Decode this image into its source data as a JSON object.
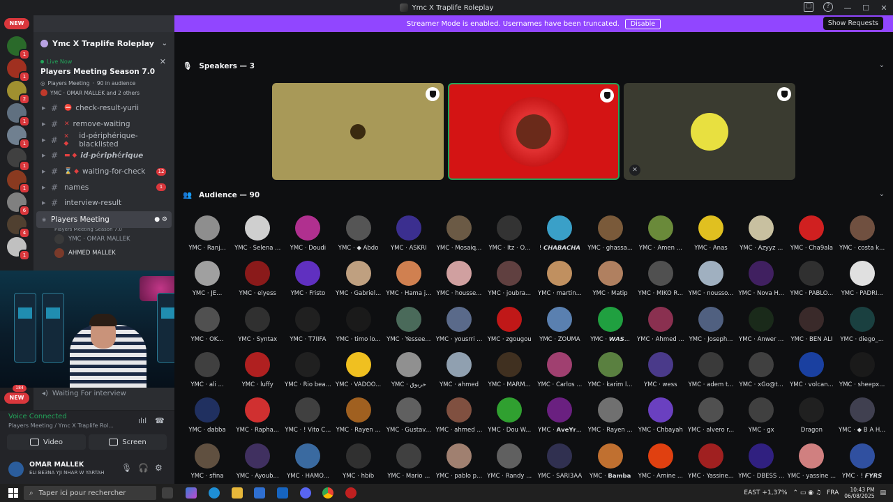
{
  "window": {
    "title": "Ymc X Traplife Roleplay"
  },
  "banner": {
    "message": "Streamer Mode is enabled. Usernames have been truncated.",
    "disable_label": "Disable",
    "show_requests": "Show Requests"
  },
  "rail": {
    "new_label": "NEW",
    "badges": [
      "1",
      "1",
      "2",
      "1",
      "1",
      "1",
      "1",
      "6",
      "4",
      "1"
    ],
    "bottom_badge": "184",
    "new_label_2": "NEW"
  },
  "sidebar": {
    "server_name": "Ymc X Traplife Roleplay",
    "live": {
      "label": "Live Now",
      "title": "Players Meeting Season 7.0",
      "stage_name": "Players Meeting",
      "audience": "90 in audience",
      "speakers_text": "YMC · OMAR MALLEK and 2 others"
    },
    "channels": [
      {
        "name": "check-result-yurii",
        "prefix": "⛔",
        "badge": ""
      },
      {
        "name": "remove-waiting",
        "prefix": "✕",
        "badge": ""
      },
      {
        "name": "id-périphérique-blacklisted",
        "prefix": "✕ ◆",
        "badge": ""
      },
      {
        "name": "𝙞𝙙-𝙥é𝙧𝙞𝙥𝙝é𝙧𝙞𝙦𝙪𝙚",
        "prefix": "▬ ◆",
        "badge": ""
      },
      {
        "name": "waiting-for-check",
        "prefix": "⌛ ◆",
        "badge": "12"
      },
      {
        "name": "names",
        "prefix": "",
        "badge": "1"
      },
      {
        "name": "interview-result",
        "prefix": "",
        "badge": ""
      }
    ],
    "active_stage": {
      "name": "Players Meeting",
      "sub": "Players Meeting Season 7.0"
    },
    "voice_users": [
      "YMC · OMAR MALLEK",
      "AHMED MALLEK"
    ],
    "waiting_channel": "Waiting For interview"
  },
  "voice": {
    "status": "Voice Connected",
    "location": "Players Meeting / Ymc X Traplife Rol...",
    "video_label": "Video",
    "screen_label": "Screen"
  },
  "user": {
    "name": "OMAR MALLEK",
    "status": "ELI BE3NA YJI NHAR W YARTAH"
  },
  "stage": {
    "speakers_label": "Speakers — 3",
    "audience_label": "Audience — 90",
    "speakers": [
      {
        "bg": "#a89958"
      },
      {
        "bg": "#d41414"
      },
      {
        "bg": "#3a3b30"
      }
    ],
    "audience": [
      "YMC · Ranj...",
      "YMC · Selena ...",
      "YMC · Doudi",
      "YMC · ◆ Abdo",
      "YMC · ASKRI",
      "YMC · Mosaiq...",
      "YMC · Itz · O...",
      "! 𝘾𝙃𝘼𝘽𝘼𝘾𝙃𝘼",
      "YMC · ghassa...",
      "YMC · Amen ...",
      "YMC · Anas",
      "YMC · Azyyz ...",
      "YMC · Cha9ala",
      "YMC · costa k...",
      "YMC · JE...",
      "YMC · elyess",
      "YMC · Fristo",
      "YMC · Gabriel...",
      "YMC · Hama j...",
      "YMC · housse...",
      "YMC · joubra...",
      "YMC · martin...",
      "YMC · Matip",
      "YMC · MIKO R...",
      "YMC · nousso...",
      "YMC · Nova H...",
      "YMC · PABLO...",
      "YMC · PADRI...",
      "YMC · OK...",
      "YMC · Syntax",
      "YMC · T7IIFA",
      "YMC · timo lo...",
      "YMC · Yessee...",
      "YMC · yousrri ...",
      "YMC · zgougou",
      "YMC · ZOUMA",
      "YMC · 𝙒𝘼𝙎...",
      "YMC · Ahmed ...",
      "YMC · Joseph...",
      "YMC · Anwer ...",
      "YMC · BEN ALI",
      "YMC · diego_...",
      "YMC · ali ...",
      "YMC · luffy",
      "YMC · Rio bea...",
      "YMC · VADOO...",
      "YMC · خربوق",
      "YMC · ahmed",
      "YMC · MARM...",
      "YMC · Carlos ...",
      "YMC · karim l...",
      "YMC · wess",
      "YMC · adem t...",
      "YMC · xGo@t...",
      "YMC · volcan...",
      "YMC · sheepx...",
      "YMC · dabba",
      "YMC · Rapha...",
      "YMC · ! Vito C...",
      "YMC · Rayen ...",
      "YMC · Gustav...",
      "YMC · ahmed ...",
      "YMC · Dou W...",
      "YMC · 𝗔𝘃𝗲𝗬𝗿...",
      "YMC · Rayen ...",
      "YMC · Chbayah",
      "YMC · alvero r...",
      "YMC · gx",
      "Dragon",
      "YMC · ◆ B A H...",
      "YMC · sfina",
      "YMC · Ayoub...",
      "YMC · HAMO...",
      "YMC · hbib",
      "YMC · Mario ...",
      "YMC · pablo p...",
      "YMC · Randy ...",
      "YMC · SARI3AA",
      "YMC · 𝗕𝗮𝗺𝗯𝗮",
      "YMC · Amine ...",
      "YMC · Yassine...",
      "YMC · DBESS ...",
      "YMC · yassine ...",
      "YMC · ! 𝙁𝙔𝙍𝙎"
    ],
    "audience_colors": [
      "#8e8e8e",
      "#cfcfcf",
      "#b0308f",
      "#555555",
      "#3b2f8f",
      "#6b5a45",
      "#333333",
      "#3aa0c8",
      "#7a5a3a",
      "#6a8a3a",
      "#e0c020",
      "#c8c0a0",
      "#d02020",
      "#705040",
      "#a0a0a0",
      "#8a1a1a",
      "#6030c0",
      "#bfa080",
      "#d08050",
      "#d0a0a0",
      "#604040",
      "#c09060",
      "#b08060",
      "#505050",
      "#a0b0c0",
      "#402060",
      "#303030",
      "#e0e0e0",
      "#505050",
      "#303030",
      "#202020",
      "#1a1a1a",
      "#4a6a5a",
      "#5a6a8a",
      "#c01818",
      "#5a80b0",
      "#20a040",
      "#8a3050",
      "#506080",
      "#1a2a1a",
      "#3a2a2a",
      "#1a4040",
      "#404040",
      "#b02020",
      "#202020",
      "#f0c020",
      "#909090",
      "#90a0b0",
      "#403020",
      "#a04070",
      "#5a8040",
      "#4a3a8a",
      "#3a3a3a",
      "#404040",
      "#1a40a0",
      "#1a1a1a",
      "#203060",
      "#d03030",
      "#404040",
      "#a06020",
      "#606060",
      "#805040",
      "#30a030",
      "#6a2080",
      "#707070",
      "#6a40c0",
      "#505050",
      "#404040",
      "#202020",
      "#404050",
      "#605040",
      "#403060",
      "#3a6aa0",
      "#303030",
      "#404040",
      "#a08070",
      "#606060",
      "#303050",
      "#c07030",
      "#e04010",
      "#a02020",
      "#302080",
      "#d08080",
      "#3050a0"
    ]
  },
  "taskbar": {
    "search_placeholder": "Taper ici pour rechercher",
    "weather": "EAST +1,37%",
    "lang": "FRA",
    "time": "10:43 PM",
    "date": "06/08/2025"
  }
}
